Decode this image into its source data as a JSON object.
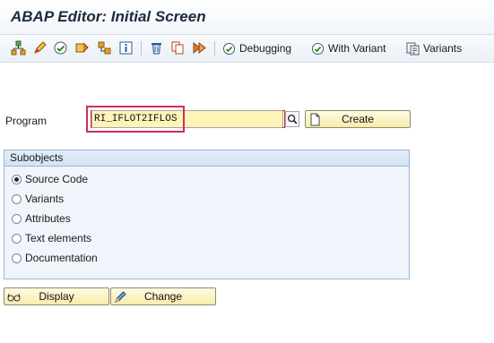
{
  "window": {
    "title": "ABAP Editor: Initial Screen"
  },
  "toolbar": {
    "icons": [
      "hierarchy-icon",
      "edit-pen-icon",
      "check-syntax-icon",
      "activate-icon",
      "where-used-icon",
      "info-icon",
      "delete-icon",
      "copy-icon",
      "execute-icon"
    ],
    "debugging_label": "Debugging",
    "with_variant_label": "With Variant",
    "variants_label": "Variants"
  },
  "program": {
    "label": "Program",
    "value": "RI_IFLOT2IFLOS",
    "create_label": "Create"
  },
  "subobjects": {
    "title": "Subobjects",
    "options": [
      {
        "label": "Source Code",
        "selected": true
      },
      {
        "label": "Variants",
        "selected": false
      },
      {
        "label": "Attributes",
        "selected": false
      },
      {
        "label": "Text elements",
        "selected": false
      },
      {
        "label": "Documentation",
        "selected": false
      }
    ]
  },
  "actions": {
    "display_label": "Display",
    "change_label": "Change"
  },
  "colors": {
    "field_bg": "#fff4b8",
    "highlight_box": "#c8325a",
    "button_bg": "#f8ecaa",
    "group_border": "#9cb6d3"
  }
}
